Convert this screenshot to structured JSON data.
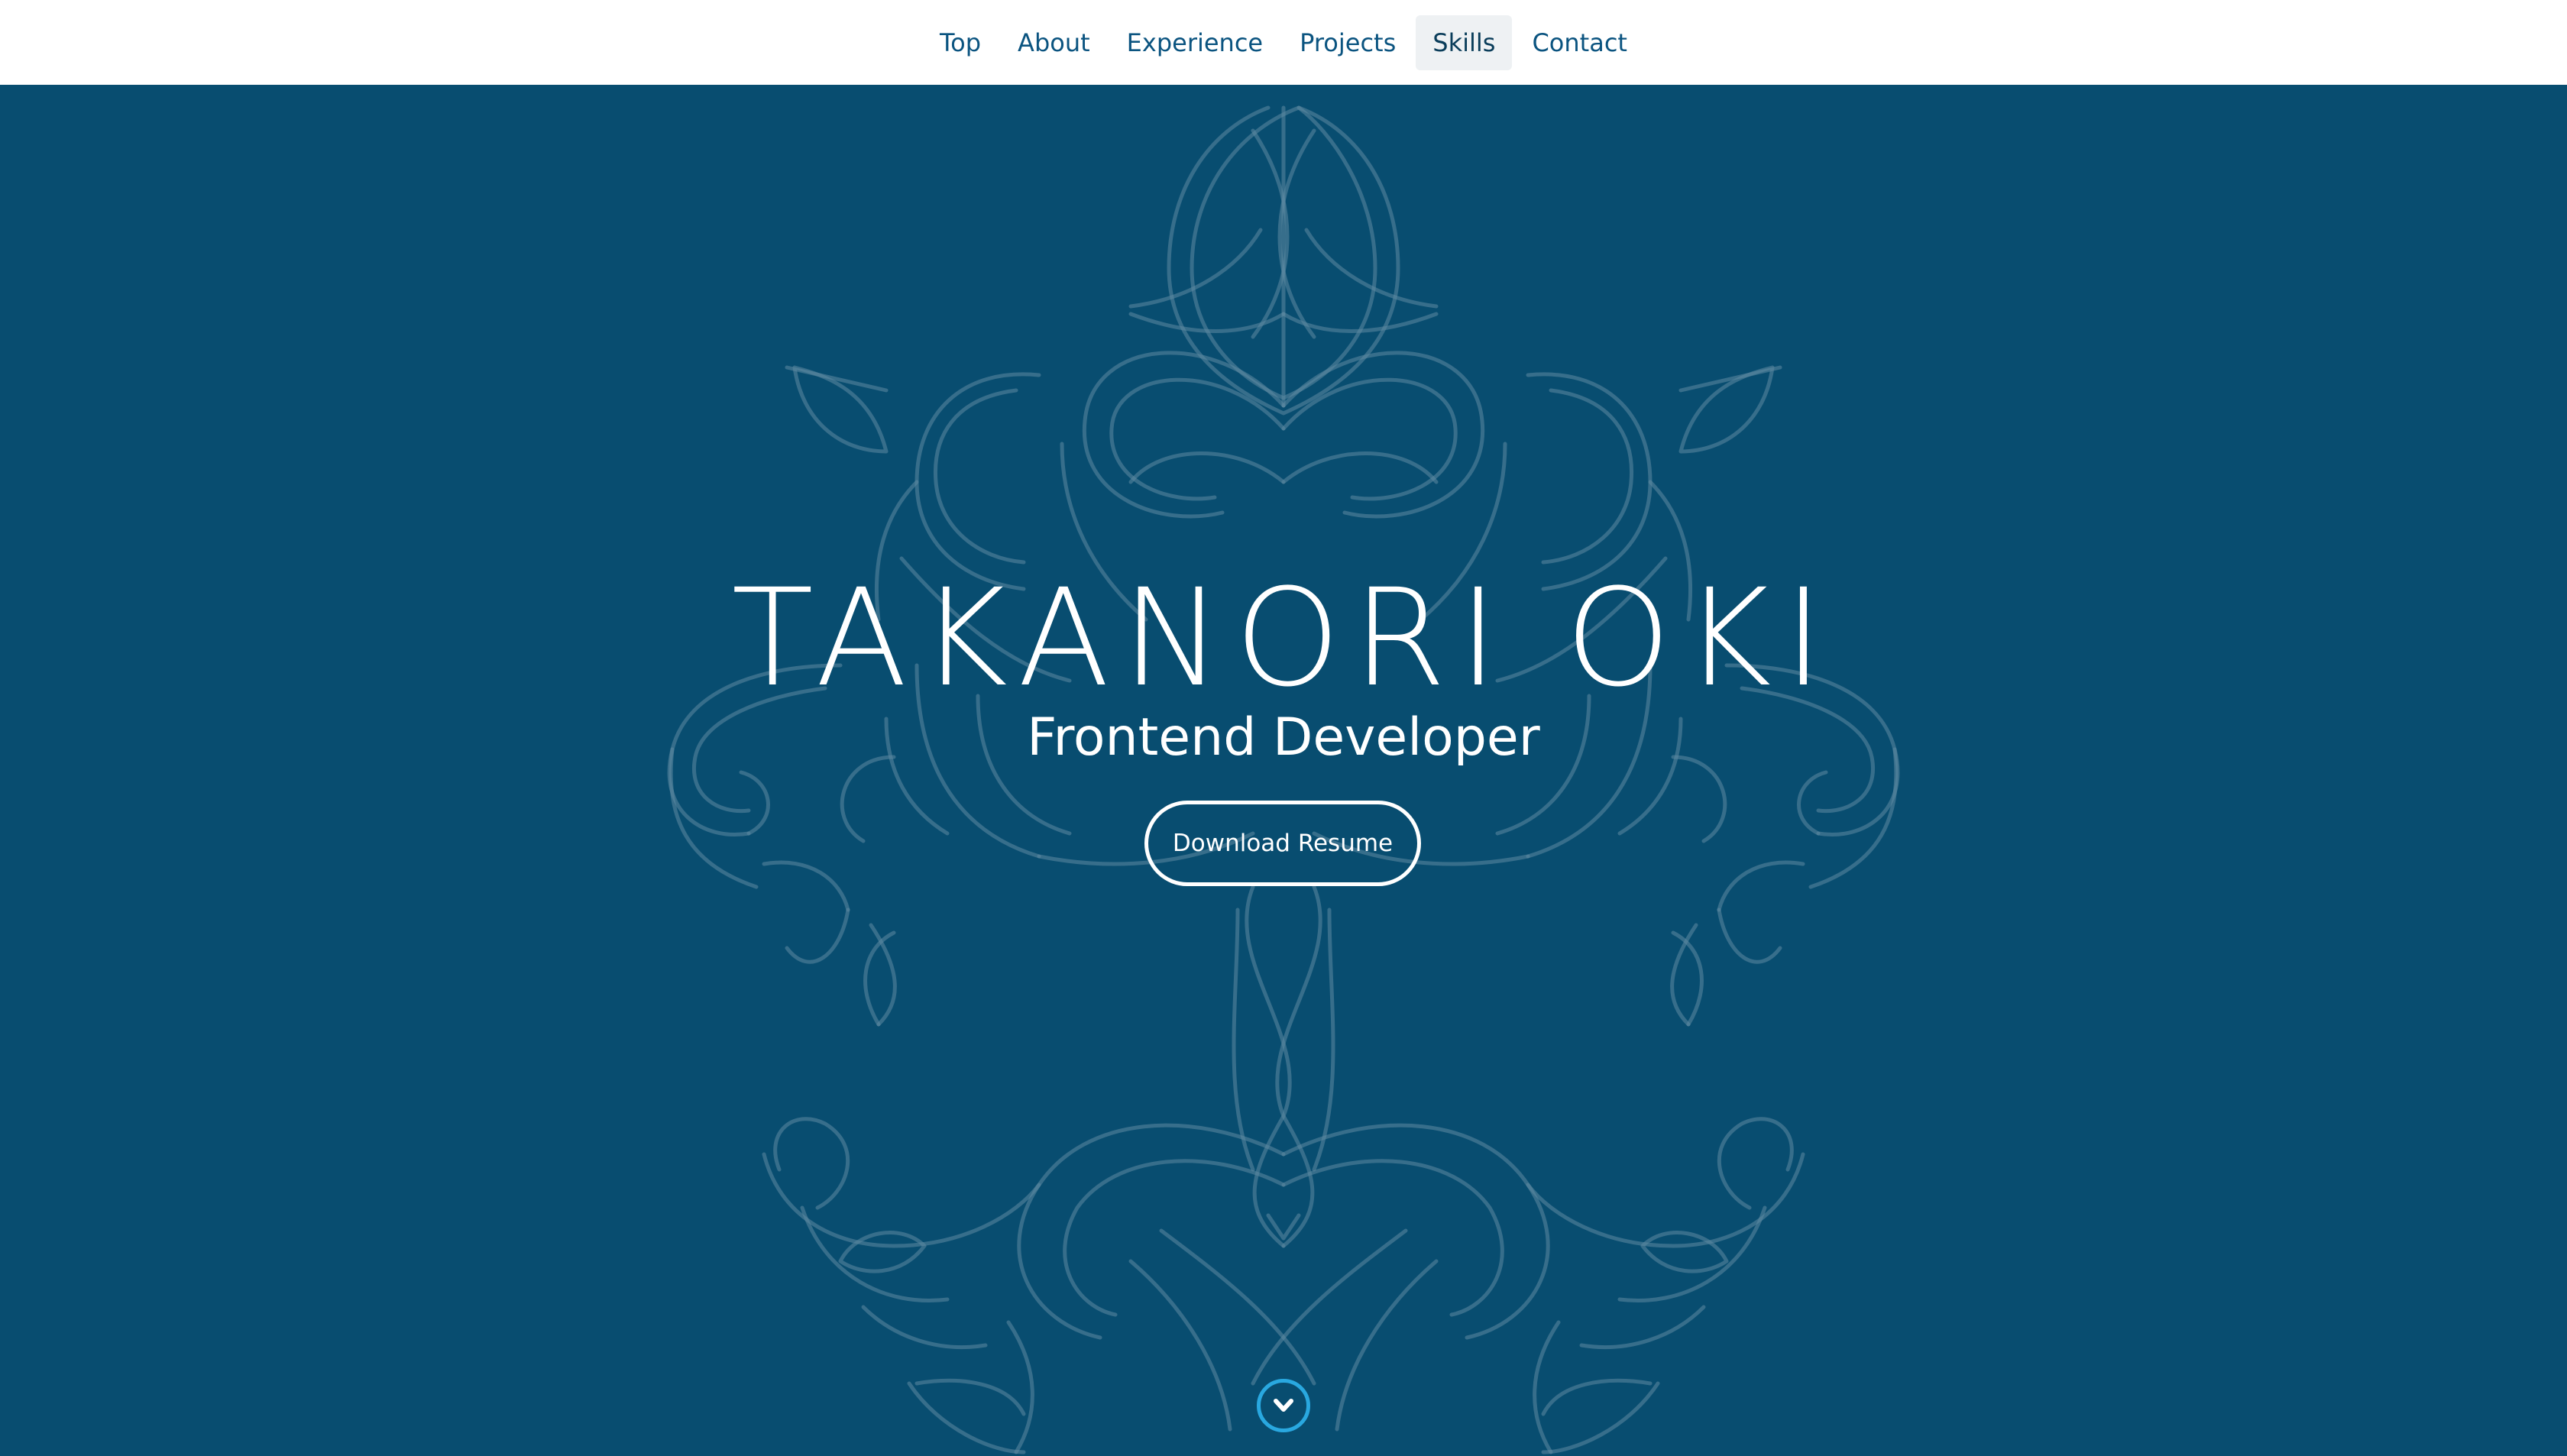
{
  "nav": {
    "items": [
      {
        "label": "Top"
      },
      {
        "label": "About"
      },
      {
        "label": "Experience"
      },
      {
        "label": "Projects"
      },
      {
        "label": "Skills",
        "active": true
      },
      {
        "label": "Contact"
      }
    ]
  },
  "hero": {
    "title": "TAKANORI OKI",
    "subtitle": "Frontend Developer",
    "resume_button": "Download Resume",
    "scroll_icon": "chevron-down-icon"
  },
  "colors": {
    "background": "#084d70",
    "nav_background": "#ffffff",
    "nav_text": "#0b5480",
    "active_nav_background": "#eef1f3",
    "scroll_button": "#29a8e0",
    "ornament": "#5f8aa3"
  }
}
